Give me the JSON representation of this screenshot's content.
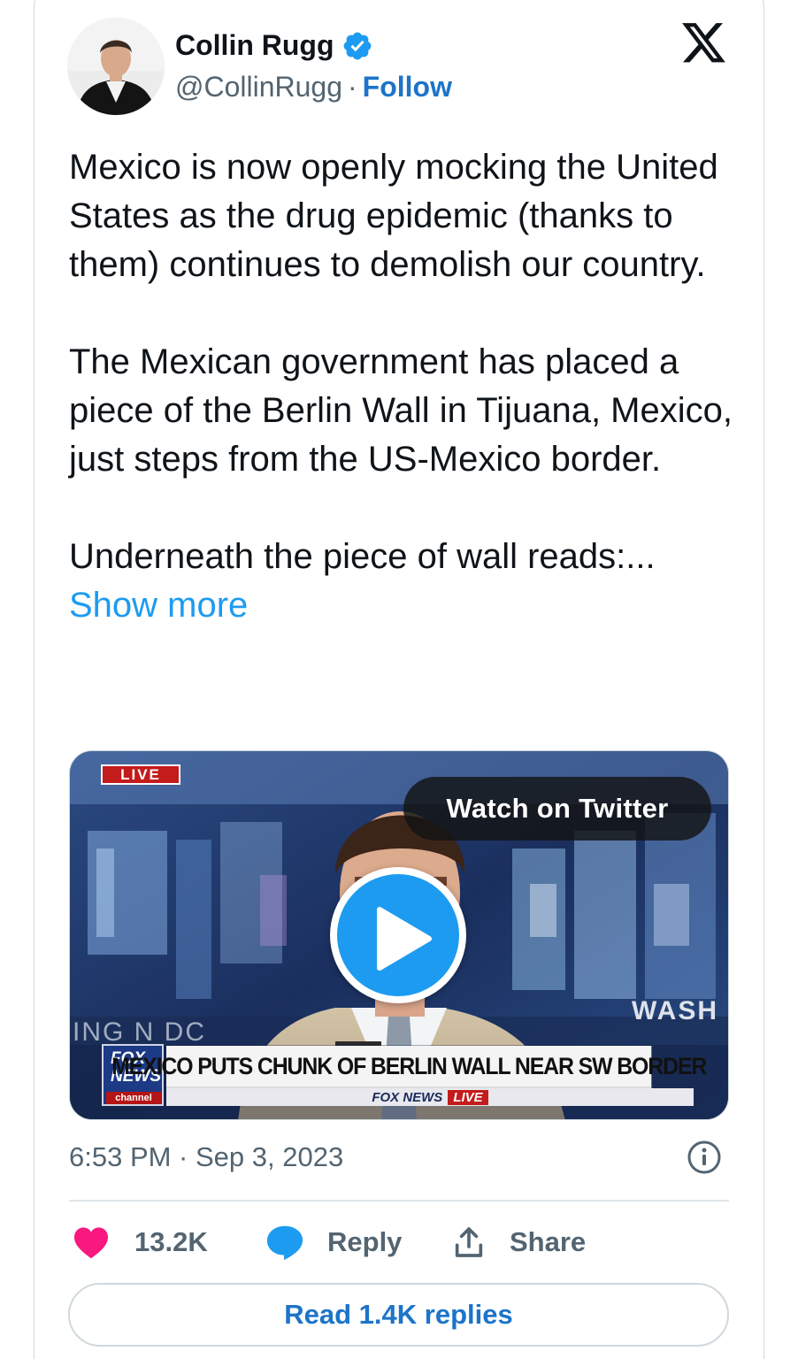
{
  "author": {
    "name": "Collin Rugg",
    "handle": "@CollinRugg",
    "separator": "·",
    "follow_label": "Follow"
  },
  "tweet": {
    "text": "Mexico is now openly mocking the United States as the drug epidemic (thanks to them) continues to demolish our country.\n\nThe Mexican government has placed a piece of the Berlin Wall in Tijuana, Mexico, just steps from the US-Mexico border.\n\nUnderneath the piece of wall reads:... ",
    "show_more_label": "Show more",
    "timestamp": "6:53 PM · Sep 3, 2023"
  },
  "media": {
    "watch_label": "Watch on Twitter",
    "live_tag": "LIVE",
    "chyron": "MEXICO PUTS CHUNK OF BERLIN WALL NEAR SW BORDER",
    "network_strip": "FOX NEWS",
    "network_live": "LIVE",
    "logo_line1": "FOX",
    "logo_line2": "NEWS",
    "logo_line3": "channel",
    "background_text_right": "WASH",
    "background_text_left": "ING   N DC"
  },
  "actions": {
    "likes": "13.2K",
    "reply_label": "Reply",
    "share_label": "Share"
  },
  "read_replies_label": "Read 1.4K replies",
  "colors": {
    "accent": "#1d9bf0",
    "link": "#1d74c8",
    "like": "#f91880",
    "muted": "#536471"
  }
}
